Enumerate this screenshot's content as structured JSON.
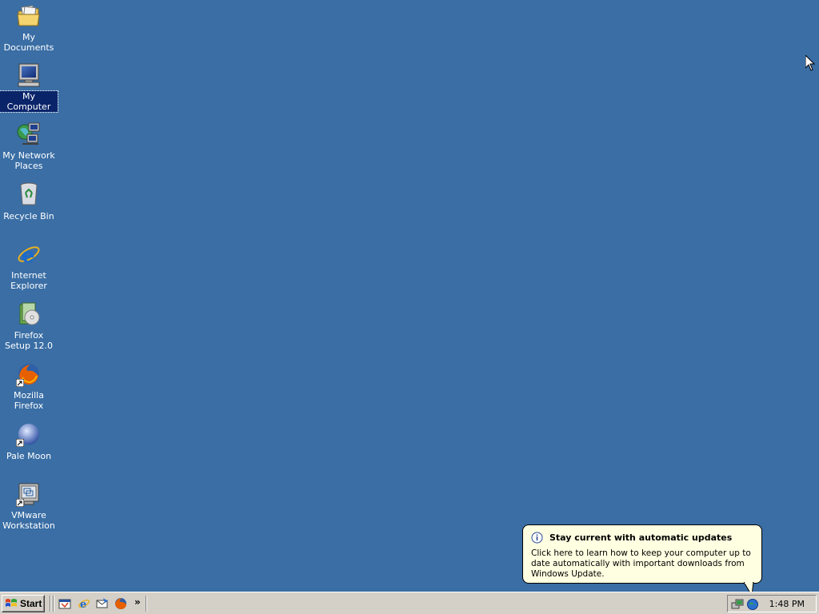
{
  "desktop": {
    "background_color": "#3a6ea5",
    "icons": [
      {
        "label": "My Documents",
        "icon": "folder-icon",
        "selected": false,
        "shortcut": false
      },
      {
        "label": "My Computer",
        "icon": "computer-icon",
        "selected": true,
        "shortcut": false
      },
      {
        "label": "My Network Places",
        "icon": "network-places-icon",
        "selected": false,
        "shortcut": false
      },
      {
        "label": "Recycle Bin",
        "icon": "recycle-bin-icon",
        "selected": false,
        "shortcut": false
      },
      {
        "label": "Internet Explorer",
        "icon": "internet-explorer-icon",
        "selected": false,
        "shortcut": false
      },
      {
        "label": "Firefox Setup 12.0",
        "icon": "installer-icon",
        "selected": false,
        "shortcut": false
      },
      {
        "label": "Mozilla Firefox",
        "icon": "firefox-icon",
        "selected": false,
        "shortcut": true
      },
      {
        "label": "Pale Moon",
        "icon": "pale-moon-icon",
        "selected": false,
        "shortcut": true
      },
      {
        "label": "VMware Workstation",
        "icon": "vmware-icon",
        "selected": false,
        "shortcut": true
      }
    ]
  },
  "balloon": {
    "title": "Stay current with automatic updates",
    "body": "Click here to learn how to keep your computer up to date automatically with important downloads from Windows Update.",
    "icon": "info-icon",
    "background_color": "#ffffe1"
  },
  "taskbar": {
    "start_label": "Start",
    "quick_launch": [
      "show-desktop-icon",
      "internet-explorer-icon",
      "outlook-express-icon",
      "firefox-icon"
    ],
    "chevron": "»",
    "tray_icons": [
      "network-icon",
      "windows-update-icon"
    ],
    "clock": "1:48 PM",
    "background_color": "#d4d0c8"
  }
}
